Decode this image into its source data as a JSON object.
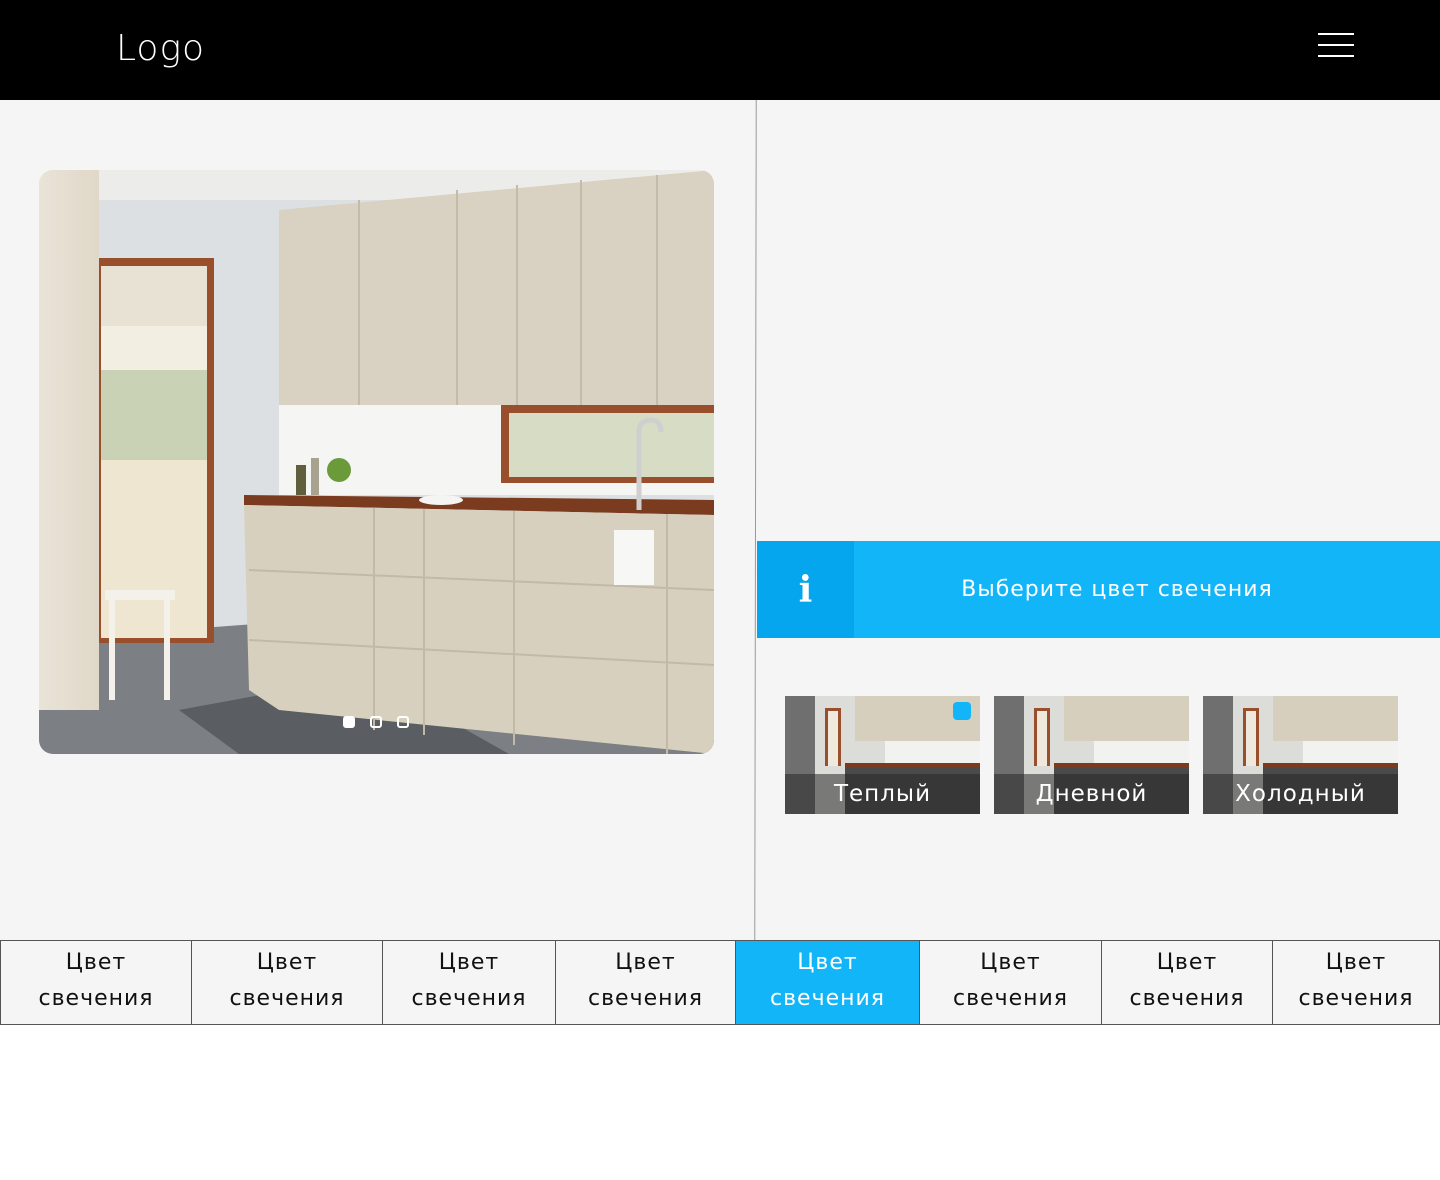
{
  "header": {
    "logo": "Logo",
    "menu_icon": "hamburger-menu-icon"
  },
  "slider": {
    "image": "kitchen-photo",
    "slide_count": 3,
    "active_slide": 1
  },
  "info_banner": {
    "icon_text": "i",
    "text": "Выберите цвет свечения"
  },
  "options": [
    {
      "label": "Теплый",
      "selected": true
    },
    {
      "label": "Дневной",
      "selected": false
    },
    {
      "label": "Холодный",
      "selected": false
    }
  ],
  "tabs": [
    {
      "label_line1": "Цвет",
      "label_line2": "свечения",
      "active": false
    },
    {
      "label_line1": "Цвет",
      "label_line2": "свечения",
      "active": false
    },
    {
      "label_line1": "Цвет",
      "label_line2": "свечения",
      "active": false
    },
    {
      "label_line1": "Цвет",
      "label_line2": "свечения",
      "active": false
    },
    {
      "label_line1": "Цвет",
      "label_line2": "свечения",
      "active": true
    },
    {
      "label_line1": "Цвет",
      "label_line2": "свечения",
      "active": false
    },
    {
      "label_line1": "Цвет",
      "label_line2": "свечения",
      "active": false
    },
    {
      "label_line1": "Цвет",
      "label_line2": "свечения",
      "active": false
    }
  ],
  "colors": {
    "accent": "#12b5f8",
    "accent_dark": "#05a6ee",
    "header_bg": "#000000",
    "panel_bg": "#f5f5f5"
  }
}
